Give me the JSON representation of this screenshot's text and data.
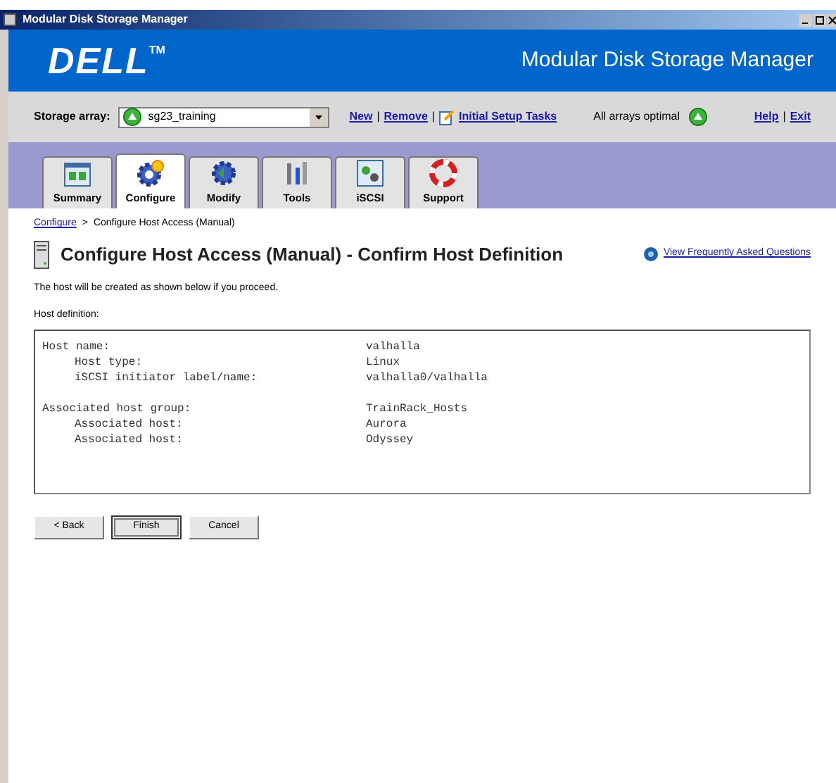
{
  "window": {
    "title": "Modular Disk Storage Manager"
  },
  "header": {
    "logo": "DELL",
    "trademark": "TM",
    "product": "Modular Disk Storage Manager"
  },
  "toolbar": {
    "label": "Storage array:",
    "array": "sg23_training",
    "links": [
      "New",
      "Remove"
    ],
    "separators": [
      "|",
      "|"
    ],
    "right_separator": "|",
    "setup_link": "Initial Setup Tasks",
    "status": "All arrays optimal",
    "right_links": [
      "Help",
      "Exit"
    ]
  },
  "tabs": [
    {
      "label": "Summary",
      "selected": false,
      "kind": "summary"
    },
    {
      "label": "Configure",
      "selected": true,
      "kind": "configure"
    },
    {
      "label": "Modify",
      "selected": false,
      "kind": "modify"
    },
    {
      "label": "Tools",
      "selected": false,
      "kind": "tools"
    },
    {
      "label": "iSCSI",
      "selected": false,
      "kind": "iscsi"
    },
    {
      "label": "Support",
      "selected": false,
      "kind": "support"
    }
  ],
  "breadcrumb": {
    "link": "Configure",
    "separator": ">",
    "current": "Configure Host Access (Manual)"
  },
  "page_title": "Configure Host Access (Manual) - Confirm Host Definition",
  "faq_link": "View Frequently Asked Questions",
  "intro": "The host will be created as shown below if you proceed.",
  "definition_label": "Host definition:",
  "definition": [
    {
      "label": "Host name:",
      "value": "valhalla",
      "children": [
        {
          "label": "Host type:",
          "value": "Linux"
        },
        {
          "label": "iSCSI initiator label/name:",
          "value": "valhalla0/valhalla"
        }
      ]
    },
    {
      "label": "Associated host group:",
      "value": "TrainRack_Hosts",
      "children": [
        {
          "label": "Associated host:",
          "value": "Aurora"
        },
        {
          "label": "Associated host:",
          "value": "Odyssey"
        }
      ]
    }
  ],
  "buttons": [
    {
      "label": "< Back",
      "selected": false
    },
    {
      "label": "Finish",
      "selected": true
    },
    {
      "label": "Cancel",
      "selected": false
    }
  ]
}
